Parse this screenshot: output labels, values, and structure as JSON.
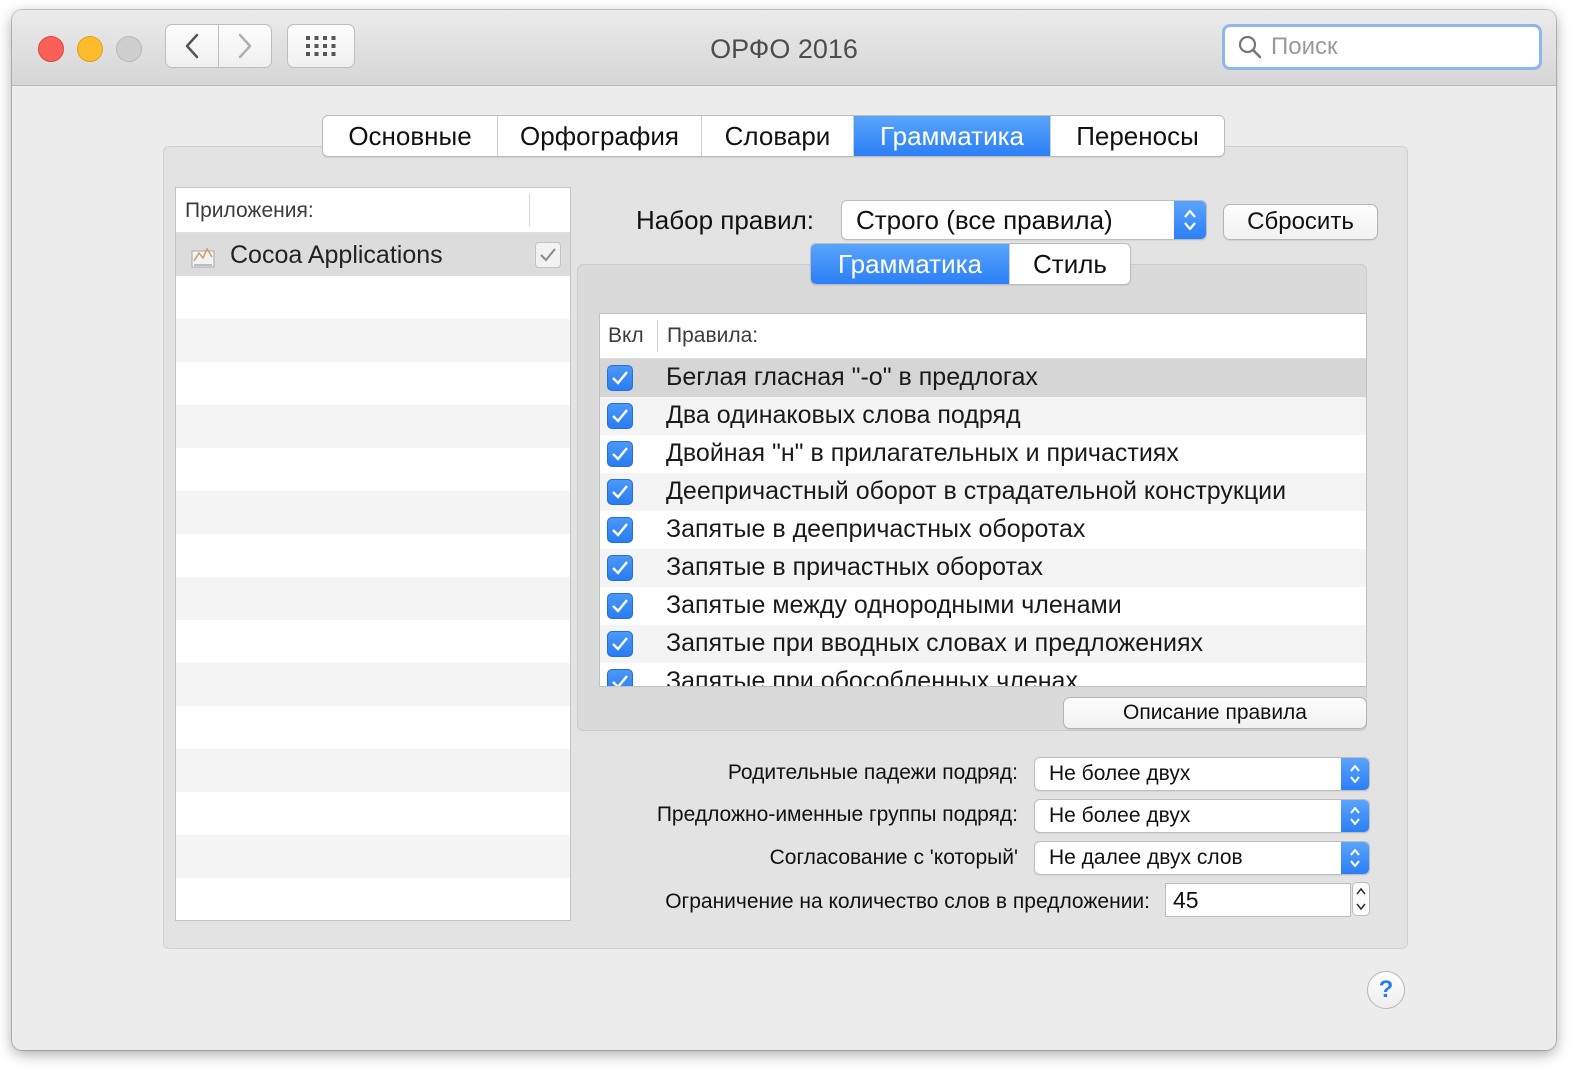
{
  "window": {
    "title": "ОРФО 2016"
  },
  "search": {
    "placeholder": "Поиск"
  },
  "tabs": [
    {
      "label": "Основные"
    },
    {
      "label": "Орфография"
    },
    {
      "label": "Словари"
    },
    {
      "label": "Грамматика",
      "active": true
    },
    {
      "label": "Переносы"
    }
  ],
  "apps": {
    "header": "Приложения:",
    "items": [
      {
        "name": "Cocoa Applications",
        "checked": true
      }
    ]
  },
  "ruleset": {
    "label": "Набор правил:",
    "value": "Строго (все правила)",
    "reset_label": "Сбросить"
  },
  "subtabs": [
    {
      "label": "Грамматика",
      "active": true
    },
    {
      "label": "Стиль"
    }
  ],
  "rules": {
    "col_enabled": "Вкл",
    "col_rules": "Правила:",
    "items": [
      {
        "text": "Беглая гласная \"-о\" в предлогах",
        "checked": true,
        "selected": true
      },
      {
        "text": "Два одинаковых слова подряд",
        "checked": true
      },
      {
        "text": "Двойная \"н\" в прилагательных и причастиях",
        "checked": true
      },
      {
        "text": "Деепричастный оборот в страдательной конструкции",
        "checked": true
      },
      {
        "text": "Запятые в деепричастных оборотах",
        "checked": true
      },
      {
        "text": "Запятые в причастных оборотах",
        "checked": true
      },
      {
        "text": "Запятые между однородными членами",
        "checked": true
      },
      {
        "text": "Запятые при вводных словах и предложениях",
        "checked": true
      },
      {
        "text": "Запятые при обособленных членах",
        "checked": true
      }
    ],
    "describe_label": "Описание правила"
  },
  "options": {
    "genitive": {
      "label": "Родительные падежи подряд:",
      "value": "Не более двух"
    },
    "prep_groups": {
      "label": "Предложно-именные группы подряд:",
      "value": "Не более двух"
    },
    "kotory": {
      "label": "Согласование с 'который'",
      "value": "Не далее двух слов"
    },
    "word_limit": {
      "label": "Ограничение на количество слов в предложении:",
      "value": "45"
    }
  },
  "help": {
    "label": "?"
  },
  "colors": {
    "accent": "#2b7ff7",
    "selected_row": "#d6d6d6",
    "window_bg": "#ececec"
  }
}
